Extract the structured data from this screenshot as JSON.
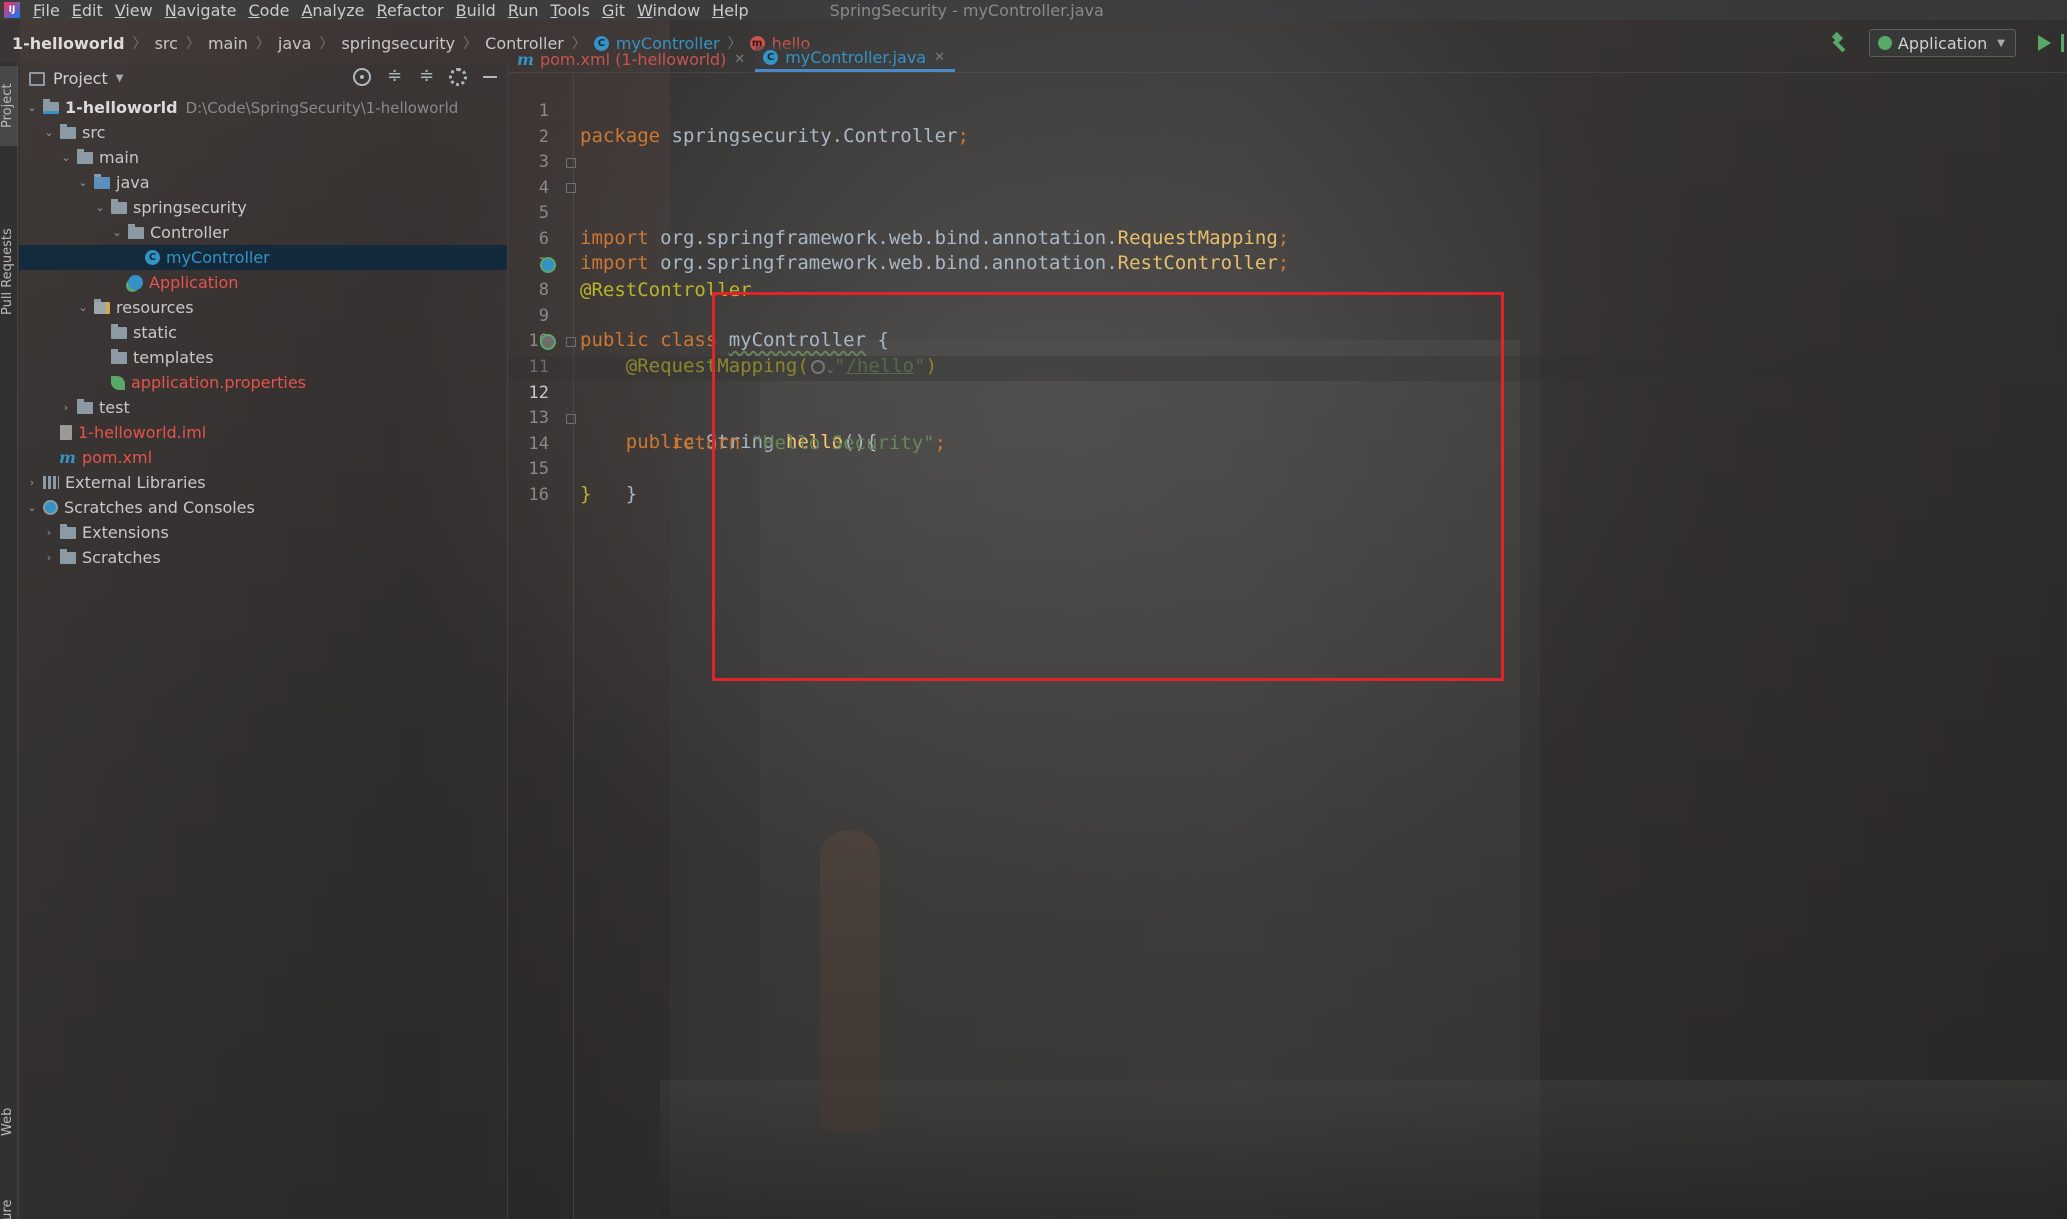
{
  "menu": {
    "items": [
      "File",
      "Edit",
      "View",
      "Navigate",
      "Code",
      "Analyze",
      "Refactor",
      "Build",
      "Run",
      "Tools",
      "Git",
      "Window",
      "Help"
    ],
    "window_title": "SpringSecurity - myController.java"
  },
  "breadcrumb": {
    "root": "1-helloworld",
    "parts": [
      "src",
      "main",
      "java",
      "springsecurity",
      "Controller"
    ],
    "class_name": "myController",
    "method_name": "hello"
  },
  "run_config": {
    "label": "Application"
  },
  "toolstrip": {
    "project": "Project",
    "pull_requests": "Pull Requests",
    "web": "Web",
    "structure": "Structure"
  },
  "project_panel": {
    "title": "Project",
    "tree": [
      {
        "label": "1-helloworld",
        "path": "D:\\Code\\SpringSecurity\\1-helloworld"
      },
      {
        "label": "src"
      },
      {
        "label": "main"
      },
      {
        "label": "java"
      },
      {
        "label": "springsecurity"
      },
      {
        "label": "Controller"
      },
      {
        "label": "myController"
      },
      {
        "label": "Application"
      },
      {
        "label": "resources"
      },
      {
        "label": "static"
      },
      {
        "label": "templates"
      },
      {
        "label": "application.properties"
      },
      {
        "label": "test"
      },
      {
        "label": "1-helloworld.iml"
      },
      {
        "label": "pom.xml"
      },
      {
        "label": "External Libraries"
      },
      {
        "label": "Scratches and Consoles"
      },
      {
        "label": "Extensions"
      },
      {
        "label": "Scratches"
      }
    ]
  },
  "editor_tabs": [
    {
      "label": "pom.xml (1-helloworld)"
    },
    {
      "label": "myController.java"
    }
  ],
  "code": {
    "line_numbers": [
      "1",
      "2",
      "3",
      "4",
      "5",
      "6",
      "7",
      "8",
      "9",
      "10",
      "11",
      "12",
      "13",
      "14",
      "15",
      "16"
    ],
    "l1": {
      "kw": "package",
      "rest": " springsecurity.Controller",
      "semi": ";"
    },
    "l4": {
      "kw": "import",
      "pkg": " org.springframework.web.bind.annotation.",
      "cls": "RequestMapping",
      "semi": ";"
    },
    "l5": {
      "kw": "import",
      "pkg": " org.springframework.web.bind.annotation.",
      "cls": "RestController",
      "semi": ";"
    },
    "l7": {
      "ann": "@RestController"
    },
    "l8": {
      "kw": "public class ",
      "name": "myController",
      "brace": " {"
    },
    "l10": {
      "ann": "@RequestMapping(",
      "q1": "\"",
      "url": "/hello",
      "q2": "\"",
      "close": ")"
    },
    "l11": {
      "kw": "public ",
      "type": "String ",
      "fn": "hello",
      "rest": "(){"
    },
    "l13": {
      "kw": "return ",
      "str": "\"Hello Security\"",
      "semi": ";"
    },
    "l14": {
      "brace": "}"
    },
    "l15": {
      "brace": "}"
    }
  }
}
